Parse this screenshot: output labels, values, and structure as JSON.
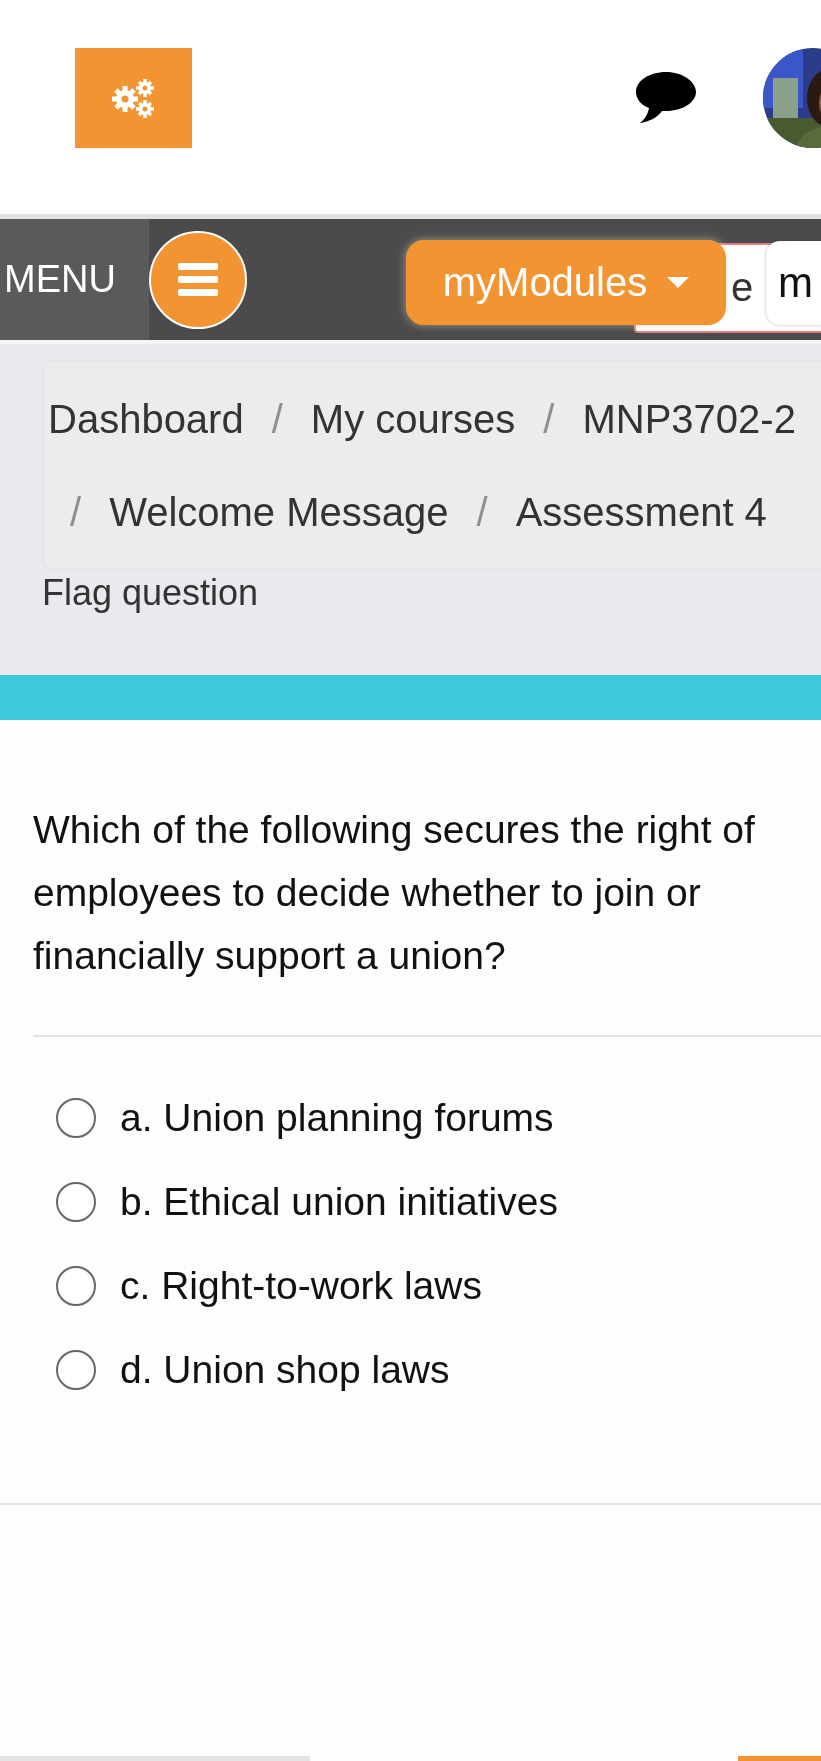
{
  "navbar": {
    "menu_label": "MENU",
    "modules_button": "myModules",
    "field_text": "e",
    "box_text": "m"
  },
  "breadcrumb": [
    {
      "label": "Dashboard"
    },
    {
      "separator": "/",
      "label": "My courses"
    },
    {
      "separator": "/",
      "label": "MNP3702-2"
    },
    {
      "separator": "/",
      "label": "Welcome Message"
    },
    {
      "separator": "/",
      "label": "Assessment 4"
    }
  ],
  "flag_link": "Flag question",
  "question": {
    "text": "Which of the following secures the right of employees to decide whether to join or financially support a union?",
    "options": [
      {
        "label": "a. Union planning forums",
        "selected": false
      },
      {
        "label": "b. Ethical union initiatives",
        "selected": false
      },
      {
        "label": "c. Right-to-work laws",
        "selected": false
      },
      {
        "label": "d. Union shop laws",
        "selected": false
      }
    ]
  }
}
